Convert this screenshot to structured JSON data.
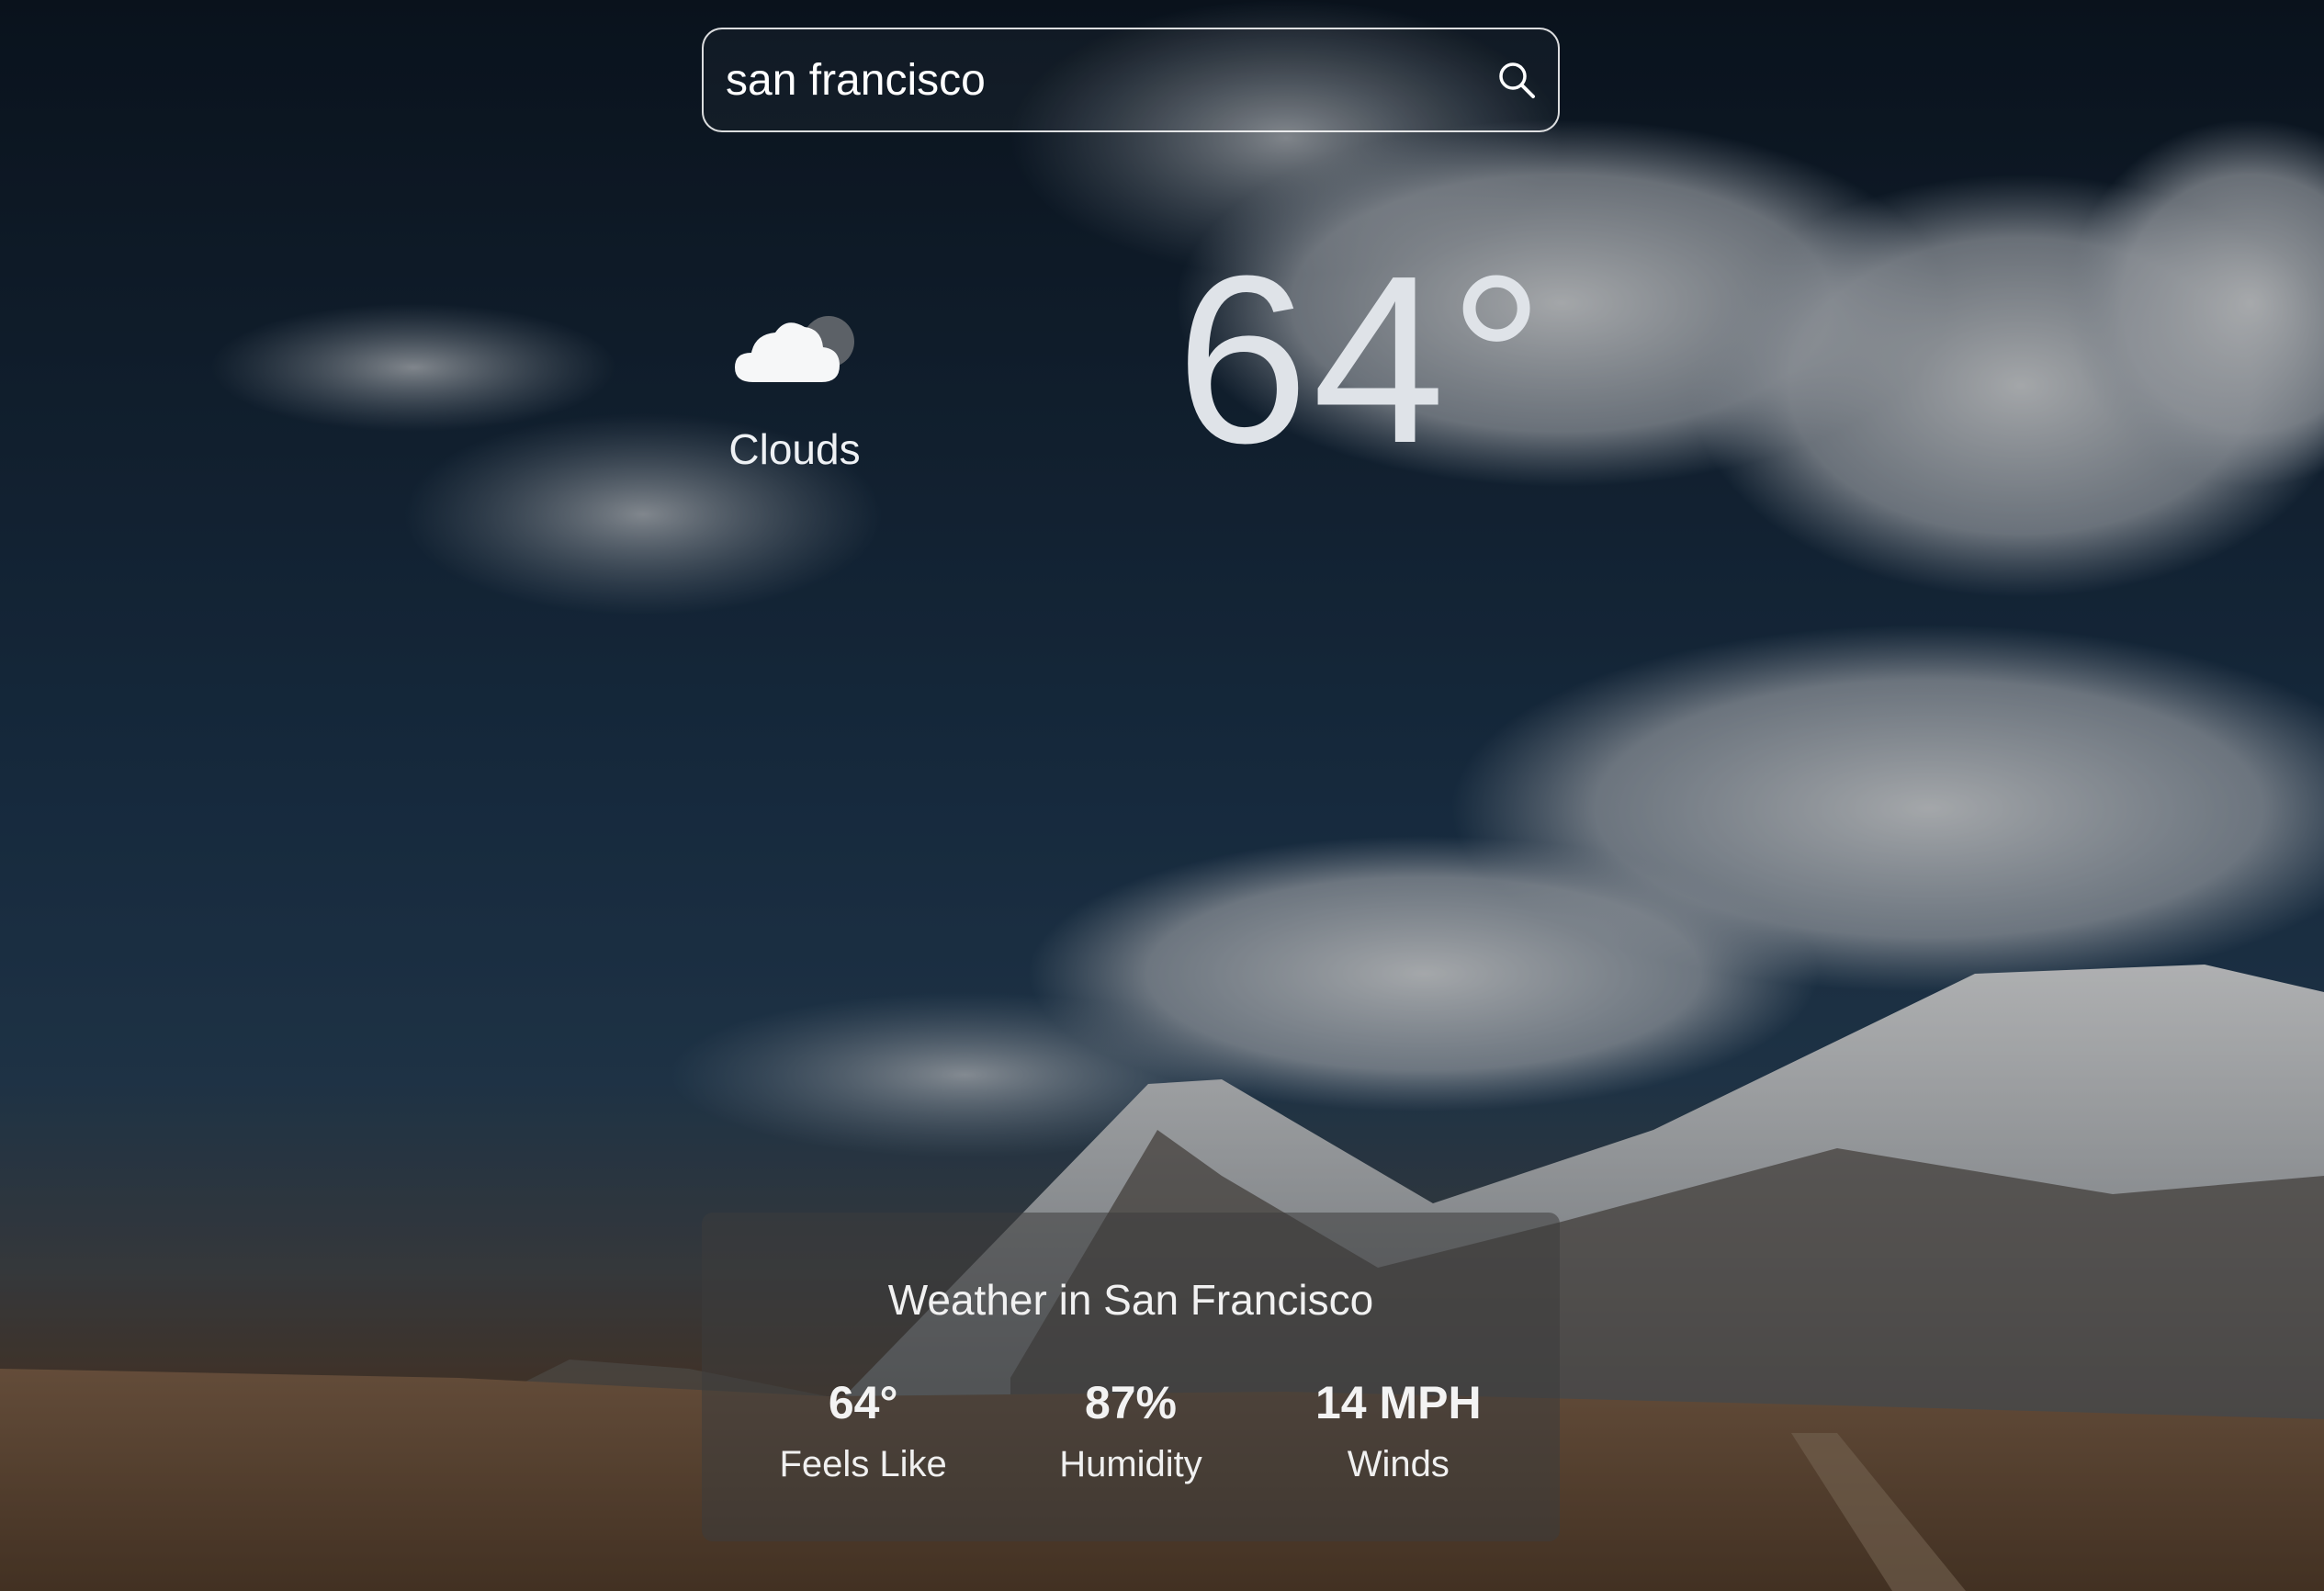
{
  "search": {
    "value": "san francisco",
    "icon": "search-icon"
  },
  "current": {
    "condition_icon": "cloud-icon",
    "condition": "Clouds",
    "temperature": "64°"
  },
  "details": {
    "title": "Weather in San Francisco",
    "stats": [
      {
        "value": "64°",
        "label": "Feels Like"
      },
      {
        "value": "87%",
        "label": "Humidity"
      },
      {
        "value": "14 MPH",
        "label": "Winds"
      }
    ]
  },
  "colors": {
    "text": "#ffffff",
    "card_bg": "#3c3c3c"
  }
}
